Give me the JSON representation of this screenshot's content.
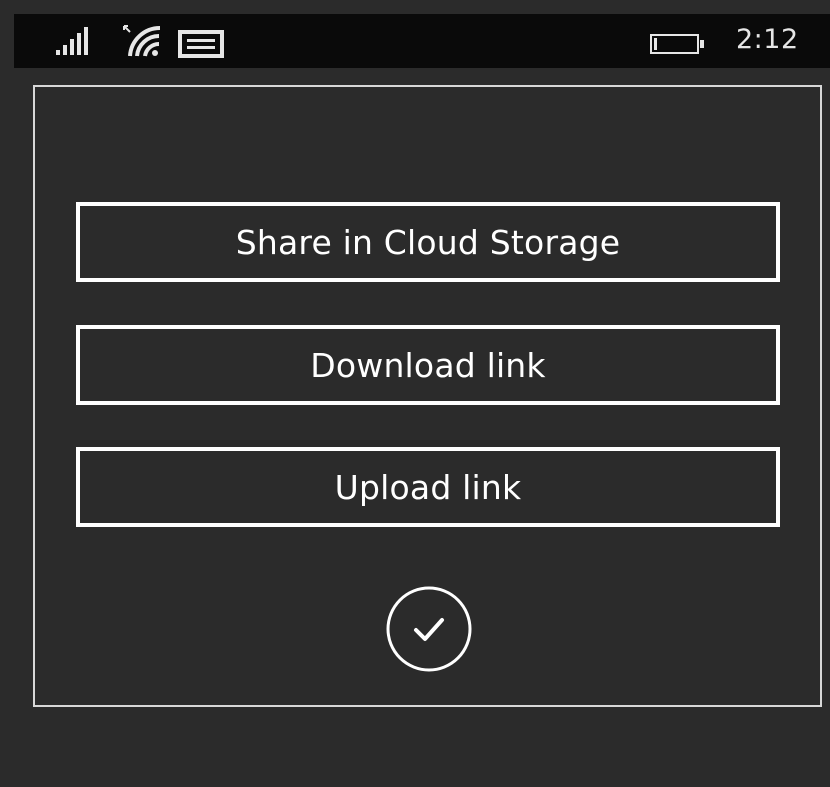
{
  "status_bar": {
    "time": "2:12",
    "icons": [
      "signal-strength-icon",
      "wifi-icon",
      "message-icon",
      "battery-icon"
    ]
  },
  "dialog": {
    "options": [
      {
        "label": "Share in Cloud Storage"
      },
      {
        "label": "Download link"
      },
      {
        "label": "Upload link"
      }
    ],
    "confirm_icon": "checkmark-circle-icon"
  },
  "colors": {
    "background": "#2b2b2b",
    "status_bar": "#0a0a0a",
    "foreground": "#ffffff"
  }
}
